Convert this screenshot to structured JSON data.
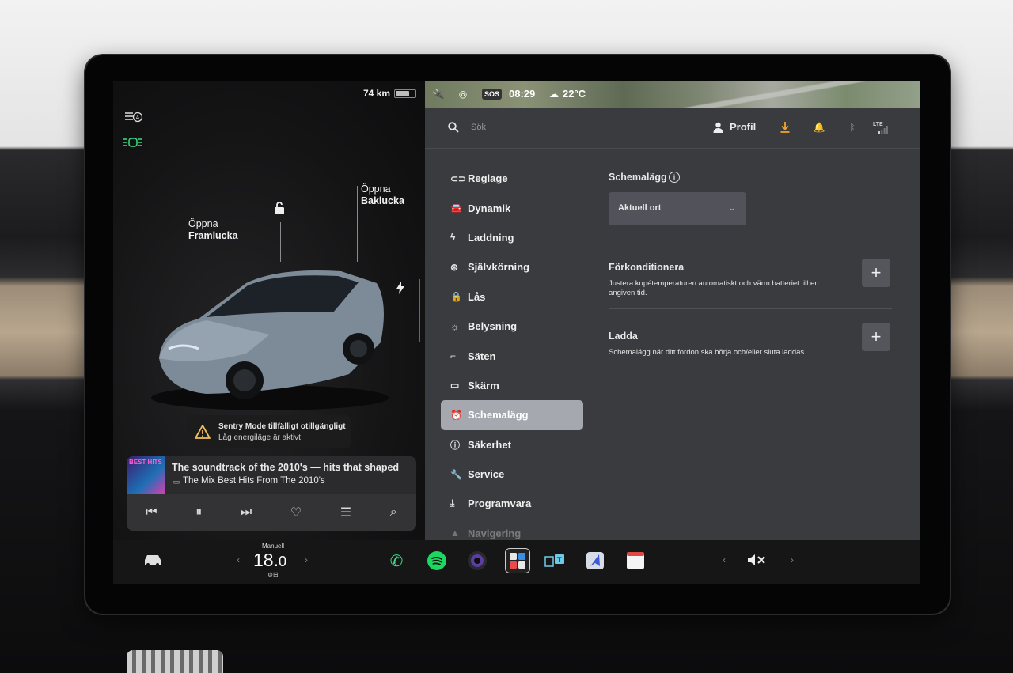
{
  "status": {
    "range": "74 km",
    "battery_level": 0.65,
    "time": "08:29",
    "temperature": "22°C",
    "sos": "SOS"
  },
  "vehicle": {
    "frunk_label_line1": "Öppna",
    "frunk_label_line2": "Framlucka",
    "trunk_label_line1": "Öppna",
    "trunk_label_line2": "Baklucka",
    "alert_title": "Sentry Mode tillfälligt otillgängligt",
    "alert_subtitle": "Låg energiläge är aktivt"
  },
  "media": {
    "album_art_text": "BEST HITS",
    "title": "The soundtrack of the 2010's — hits that shaped",
    "subtitle": "The Mix Best Hits From The 2010's"
  },
  "search": {
    "placeholder": "Sök"
  },
  "header": {
    "profile_label": "Profil",
    "network": "LTE"
  },
  "menu": {
    "items": [
      {
        "label": "Reglage",
        "icon": "toggle-icon"
      },
      {
        "label": "Dynamik",
        "icon": "car-icon"
      },
      {
        "label": "Laddning",
        "icon": "bolt-icon"
      },
      {
        "label": "Självkörning",
        "icon": "steering-wheel-icon"
      },
      {
        "label": "Lås",
        "icon": "lock-icon"
      },
      {
        "label": "Belysning",
        "icon": "sun-icon"
      },
      {
        "label": "Säten",
        "icon": "seat-icon"
      },
      {
        "label": "Skärm",
        "icon": "display-icon"
      },
      {
        "label": "Schemalägg",
        "icon": "alarm-clock-icon",
        "active": true
      },
      {
        "label": "Säkerhet",
        "icon": "info-circle-icon"
      },
      {
        "label": "Service",
        "icon": "wrench-icon"
      },
      {
        "label": "Programvara",
        "icon": "download-icon"
      },
      {
        "label": "Navigering",
        "icon": "navigation-icon"
      }
    ]
  },
  "schedule": {
    "title": "Schemalägg",
    "location_select": "Aktuell ort",
    "precondition_title": "Förkonditionera",
    "precondition_desc": "Justera kupétemperaturen automatiskt och värm batteriet till en angiven tid.",
    "charge_title": "Ladda",
    "charge_desc": "Schemalägg när ditt fordon ska börja och/eller sluta laddas.",
    "add_symbol": "+"
  },
  "climate": {
    "mode_label": "Manuell",
    "temperature_whole": "18.",
    "temperature_decimal": "0"
  },
  "colors": {
    "accent_orange": "#f0a030",
    "active_item": "#a5a8ae",
    "panel_bg": "#3a3b3e",
    "edge_lights_green": "#3ddc84"
  }
}
